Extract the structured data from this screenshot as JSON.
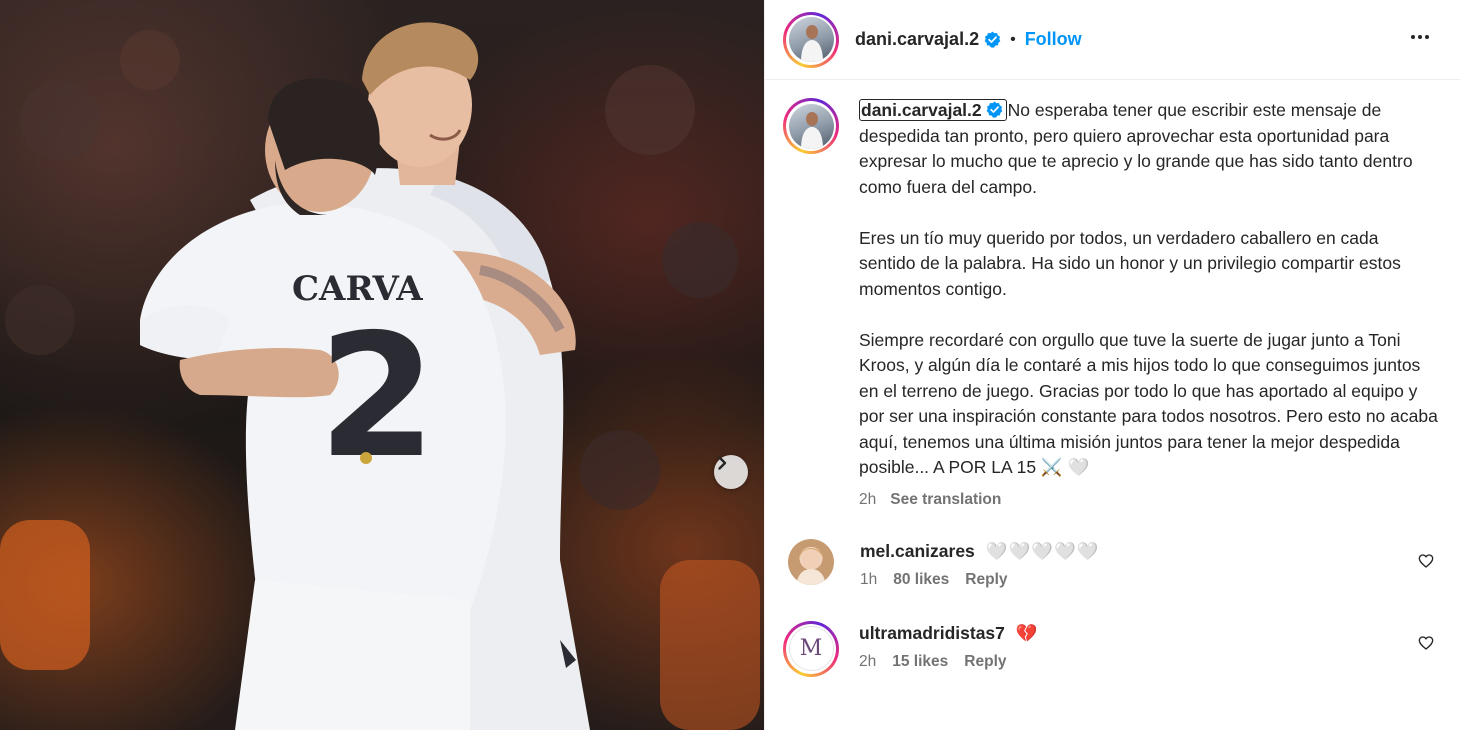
{
  "header": {
    "username": "dani.carvajal.2",
    "separator": "•",
    "follow_label": "Follow"
  },
  "photo": {
    "jersey_name": "CARVA",
    "jersey_number": "2"
  },
  "caption": {
    "username": "dani.carvajal.2",
    "paragraphs": [
      "No esperaba tener que escribir este mensaje de despedida tan pronto, pero quiero aprovechar esta oportunidad para expresar lo mucho que te aprecio y lo grande que has sido tanto dentro como fuera del campo.",
      "Eres un tío muy querido por todos, un verdadero caballero en cada sentido de la palabra. Ha sido un honor y un privilegio compartir estos momentos contigo.",
      "Siempre recordaré con orgullo que tuve la suerte de jugar junto a Toni Kroos, y algún día le contaré a mis hijos todo lo que conseguimos juntos en el terreno de juego. Gracias por todo lo que has aportado al equipo y por ser una inspiración constante para todos nosotros. Pero esto no acaba aquí, tenemos una última misión juntos para tener la mejor despedida posible... A POR LA 15 ⚔️ 🤍"
    ],
    "time": "2h",
    "see_translation": "See translation"
  },
  "comments": [
    {
      "username": "mel.canizares",
      "text": "🤍🤍🤍🤍🤍",
      "time": "1h",
      "likes": "80 likes",
      "reply": "Reply"
    },
    {
      "username": "ultramadridistas7",
      "text": "💔",
      "time": "2h",
      "likes": "15 likes",
      "reply": "Reply",
      "avatar_letter": "M"
    }
  ]
}
